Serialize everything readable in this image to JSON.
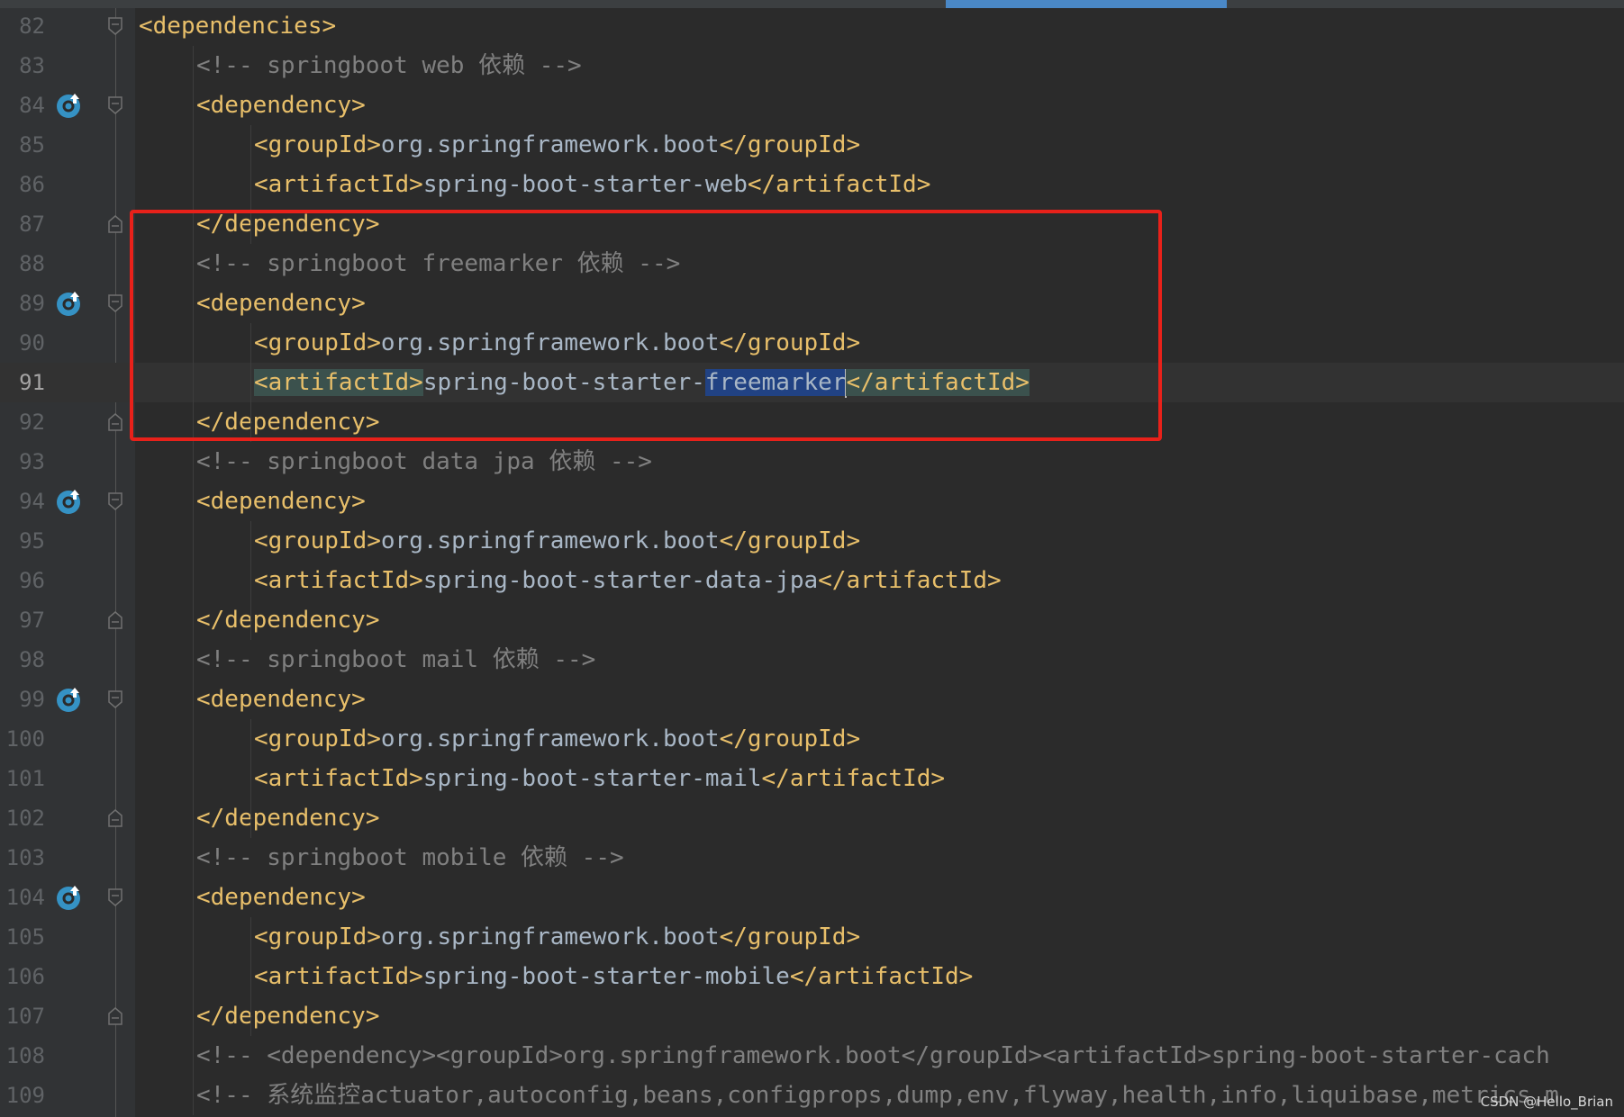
{
  "editor": {
    "lines": [
      {
        "n": "82",
        "indent": 1,
        "icon": "",
        "fold": "open",
        "parts": [
          [
            "tag",
            "<dependencies>"
          ]
        ]
      },
      {
        "n": "83",
        "indent": 2,
        "icon": "",
        "fold": "",
        "parts": [
          [
            "cmt",
            "<!-- springboot web 依赖 -->"
          ]
        ]
      },
      {
        "n": "84",
        "indent": 2,
        "icon": "run",
        "fold": "open",
        "parts": [
          [
            "tag",
            "<dependency>"
          ]
        ]
      },
      {
        "n": "85",
        "indent": 3,
        "icon": "",
        "fold": "",
        "parts": [
          [
            "tag",
            "<groupId>"
          ],
          [
            "txt",
            "org.springframework.boot"
          ],
          [
            "tag",
            "</groupId>"
          ]
        ]
      },
      {
        "n": "86",
        "indent": 3,
        "icon": "",
        "fold": "",
        "parts": [
          [
            "tag",
            "<artifactId>"
          ],
          [
            "txt",
            "spring-boot-starter-web"
          ],
          [
            "tag",
            "</artifactId>"
          ]
        ]
      },
      {
        "n": "87",
        "indent": 2,
        "icon": "",
        "fold": "close",
        "parts": [
          [
            "tag",
            "</dependency>"
          ]
        ]
      },
      {
        "n": "88",
        "indent": 2,
        "icon": "",
        "fold": "",
        "parts": [
          [
            "cmt",
            "<!-- springboot freemarker 依赖 -->"
          ]
        ]
      },
      {
        "n": "89",
        "indent": 2,
        "icon": "run",
        "fold": "open",
        "parts": [
          [
            "tag",
            "<dependency>"
          ]
        ]
      },
      {
        "n": "90",
        "indent": 3,
        "icon": "",
        "fold": "",
        "parts": [
          [
            "tag",
            "<groupId>"
          ],
          [
            "txt",
            "org.springframework.boot"
          ],
          [
            "tag",
            "</groupId>"
          ]
        ]
      },
      {
        "n": "91",
        "indent": 3,
        "icon": "",
        "fold": "",
        "current": true,
        "parts": [
          [
            "tag tagmatch",
            "<artifactId>"
          ],
          [
            "txt",
            "spring-boot-starter-"
          ],
          [
            "txt sel",
            "freemarker"
          ],
          [
            "caret",
            ""
          ],
          [
            "tag tagmatch",
            "</artifactId>"
          ]
        ]
      },
      {
        "n": "92",
        "indent": 2,
        "icon": "",
        "fold": "close",
        "parts": [
          [
            "tag",
            "</dependency>"
          ]
        ]
      },
      {
        "n": "93",
        "indent": 2,
        "icon": "",
        "fold": "",
        "parts": [
          [
            "cmt",
            "<!-- springboot data jpa 依赖 -->"
          ]
        ]
      },
      {
        "n": "94",
        "indent": 2,
        "icon": "run",
        "fold": "open",
        "parts": [
          [
            "tag",
            "<dependency>"
          ]
        ]
      },
      {
        "n": "95",
        "indent": 3,
        "icon": "",
        "fold": "",
        "parts": [
          [
            "tag",
            "<groupId>"
          ],
          [
            "txt",
            "org.springframework.boot"
          ],
          [
            "tag",
            "</groupId>"
          ]
        ]
      },
      {
        "n": "96",
        "indent": 3,
        "icon": "",
        "fold": "",
        "parts": [
          [
            "tag",
            "<artifactId>"
          ],
          [
            "txt",
            "spring-boot-starter-data-jpa"
          ],
          [
            "tag",
            "</artifactId>"
          ]
        ]
      },
      {
        "n": "97",
        "indent": 2,
        "icon": "",
        "fold": "close",
        "parts": [
          [
            "tag",
            "</dependency>"
          ]
        ]
      },
      {
        "n": "98",
        "indent": 2,
        "icon": "",
        "fold": "",
        "parts": [
          [
            "cmt",
            "<!-- springboot mail 依赖 -->"
          ]
        ]
      },
      {
        "n": "99",
        "indent": 2,
        "icon": "run",
        "fold": "open",
        "parts": [
          [
            "tag",
            "<dependency>"
          ]
        ]
      },
      {
        "n": "100",
        "indent": 3,
        "icon": "",
        "fold": "",
        "parts": [
          [
            "tag",
            "<groupId>"
          ],
          [
            "txt",
            "org.springframework.boot"
          ],
          [
            "tag",
            "</groupId>"
          ]
        ]
      },
      {
        "n": "101",
        "indent": 3,
        "icon": "",
        "fold": "",
        "parts": [
          [
            "tag",
            "<artifactId>"
          ],
          [
            "txt",
            "spring-boot-starter-mail"
          ],
          [
            "tag",
            "</artifactId>"
          ]
        ]
      },
      {
        "n": "102",
        "indent": 2,
        "icon": "",
        "fold": "close",
        "parts": [
          [
            "tag",
            "</dependency>"
          ]
        ]
      },
      {
        "n": "103",
        "indent": 2,
        "icon": "",
        "fold": "",
        "parts": [
          [
            "cmt",
            "<!-- springboot mobile 依赖 -->"
          ]
        ]
      },
      {
        "n": "104",
        "indent": 2,
        "icon": "run",
        "fold": "open",
        "parts": [
          [
            "tag",
            "<dependency>"
          ]
        ]
      },
      {
        "n": "105",
        "indent": 3,
        "icon": "",
        "fold": "",
        "parts": [
          [
            "tag",
            "<groupId>"
          ],
          [
            "txt",
            "org.springframework.boot"
          ],
          [
            "tag",
            "</groupId>"
          ]
        ]
      },
      {
        "n": "106",
        "indent": 3,
        "icon": "",
        "fold": "",
        "parts": [
          [
            "tag",
            "<artifactId>"
          ],
          [
            "txt",
            "spring-boot-starter-mobile"
          ],
          [
            "tag",
            "</artifactId>"
          ]
        ]
      },
      {
        "n": "107",
        "indent": 2,
        "icon": "",
        "fold": "close",
        "parts": [
          [
            "tag",
            "</dependency>"
          ]
        ]
      },
      {
        "n": "108",
        "indent": 2,
        "icon": "",
        "fold": "",
        "parts": [
          [
            "cmt",
            "<!-- <dependency><groupId>org.springframework.boot</groupId><artifactId>spring-boot-starter-cach"
          ]
        ]
      },
      {
        "n": "109",
        "indent": 2,
        "icon": "",
        "fold": "",
        "parts": [
          [
            "cmt",
            "<!-- 系统监控"
          ],
          [
            "cmt",
            "actuator,autoconfig,beans,configprops,dump,env,flyway,health,info,liquibase,metrics,m"
          ]
        ]
      }
    ]
  },
  "watermark": "CSDN @Hello_Brian",
  "colors": {
    "tag": "#e8bf6a",
    "text": "#a9b7c6",
    "comment": "#808080",
    "highlight_box": "#e8211a",
    "selection": "#214283"
  }
}
